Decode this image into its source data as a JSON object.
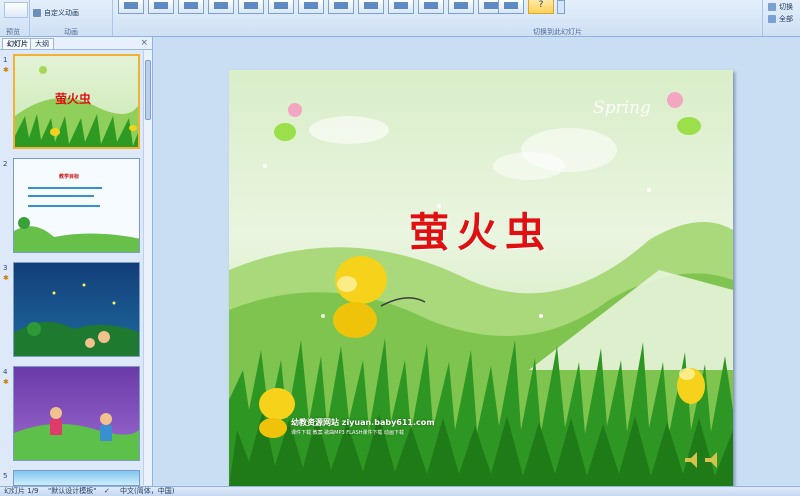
{
  "ribbon": {
    "preview_label": "预览",
    "custom_animation_label": "自定义动画",
    "animation_group_label": "动画",
    "transition_group_label": "切换到此幻灯片",
    "switch_scheme_label": "切换",
    "apply_all_label": "全部"
  },
  "panel": {
    "tabs": [
      "幻灯片",
      "大纲"
    ],
    "close_glyph": "×"
  },
  "thumbnails": [
    {
      "number": "1",
      "title": "萤火虫",
      "has_animation": true
    },
    {
      "number": "2",
      "title": "教学目标",
      "has_animation": false
    },
    {
      "number": "3",
      "title": "",
      "has_animation": true
    },
    {
      "number": "4",
      "title": "",
      "has_animation": true
    },
    {
      "number": "5",
      "title": "",
      "has_animation": false
    }
  ],
  "slide": {
    "title": "萤火虫",
    "spring_word": "Spring",
    "site_line1": "幼教资源网站 ziyuan.baby611.com",
    "site_line2": "课件下载  教案  歌曲MP3  FLASH课件下载  动画下载"
  },
  "status_bar": {
    "slide_counter": "幻灯片 1/9",
    "theme": "\"默认设计模板\"",
    "language": "中文(简体，中国)"
  },
  "colors": {
    "ribbon_bg": "#dbe8f8",
    "title_red": "#e01010",
    "selected_border": "#f0b232"
  }
}
